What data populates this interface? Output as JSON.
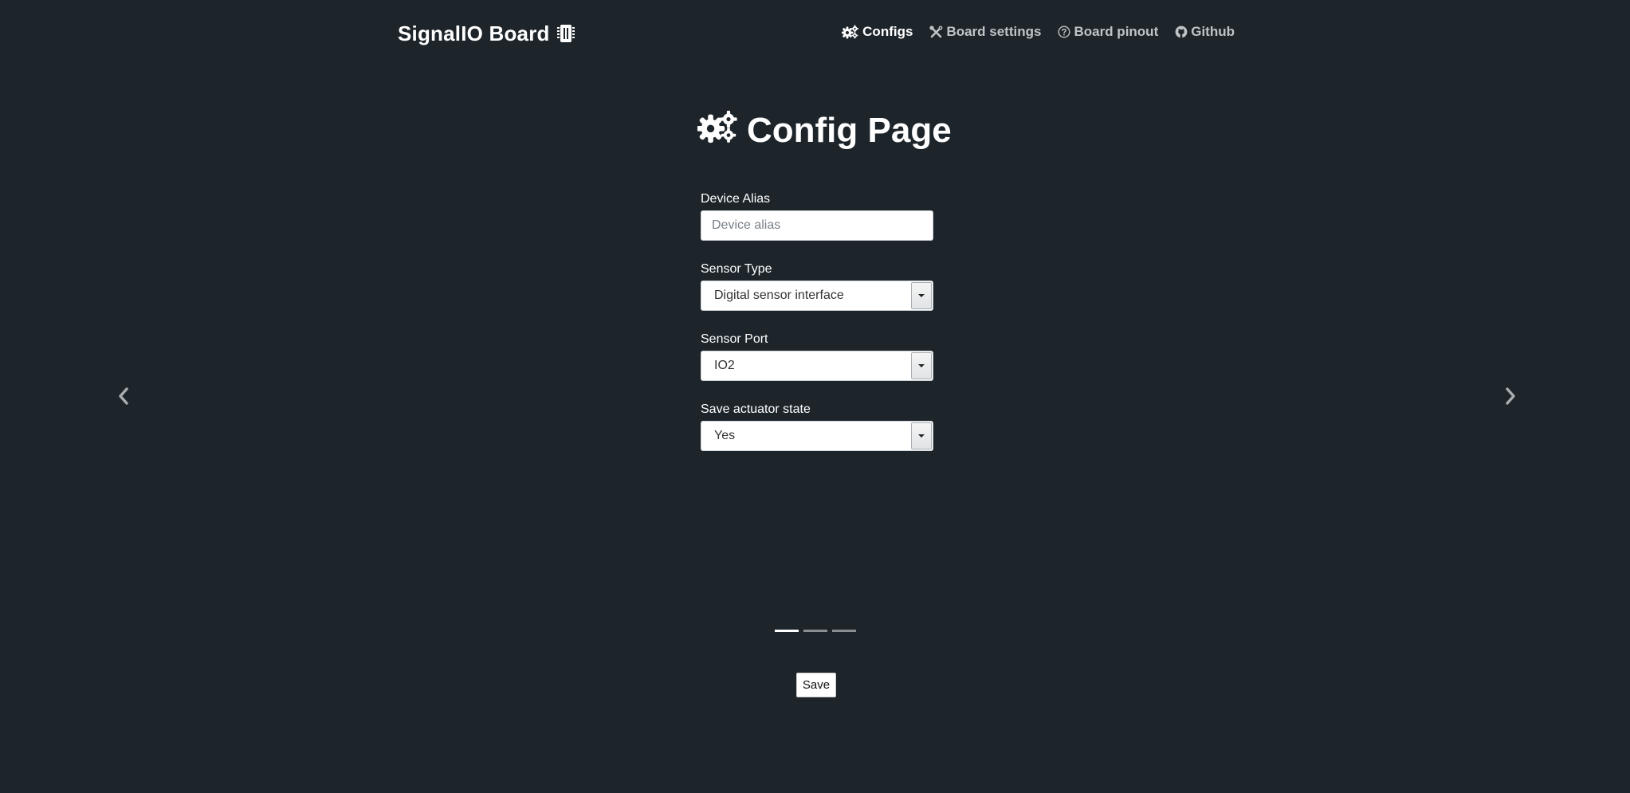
{
  "header": {
    "brand": "SignalIO Board",
    "brand_icon": "memory-chip-icon",
    "nav": [
      {
        "label": "Configs",
        "icon": "gears-icon",
        "active": true
      },
      {
        "label": "Board settings",
        "icon": "tools-icon",
        "active": false
      },
      {
        "label": "Board pinout",
        "icon": "question-circle-icon",
        "active": false
      },
      {
        "label": "Github",
        "icon": "github-icon",
        "active": false
      }
    ]
  },
  "main": {
    "title": "Config Page",
    "title_icon": "gears-icon",
    "fields": {
      "device_alias": {
        "label": "Device Alias",
        "placeholder": "Device alias",
        "value": ""
      },
      "sensor_type": {
        "label": "Sensor Type",
        "value": "Digital sensor interface"
      },
      "sensor_port": {
        "label": "Sensor Port",
        "value": "IO2"
      },
      "save_actuator_state": {
        "label": "Save actuator state",
        "value": "Yes"
      }
    },
    "save_label": "Save"
  },
  "carousel": {
    "slide_count": 3,
    "active_index": 0,
    "prev_icon": "chevron-left-icon",
    "next_icon": "chevron-right-icon"
  },
  "colors": {
    "background": "#1d252b",
    "text": "#ffffff",
    "nav_inactive": "#bfc4c8",
    "indicator_inactive": "#8a8f93"
  }
}
